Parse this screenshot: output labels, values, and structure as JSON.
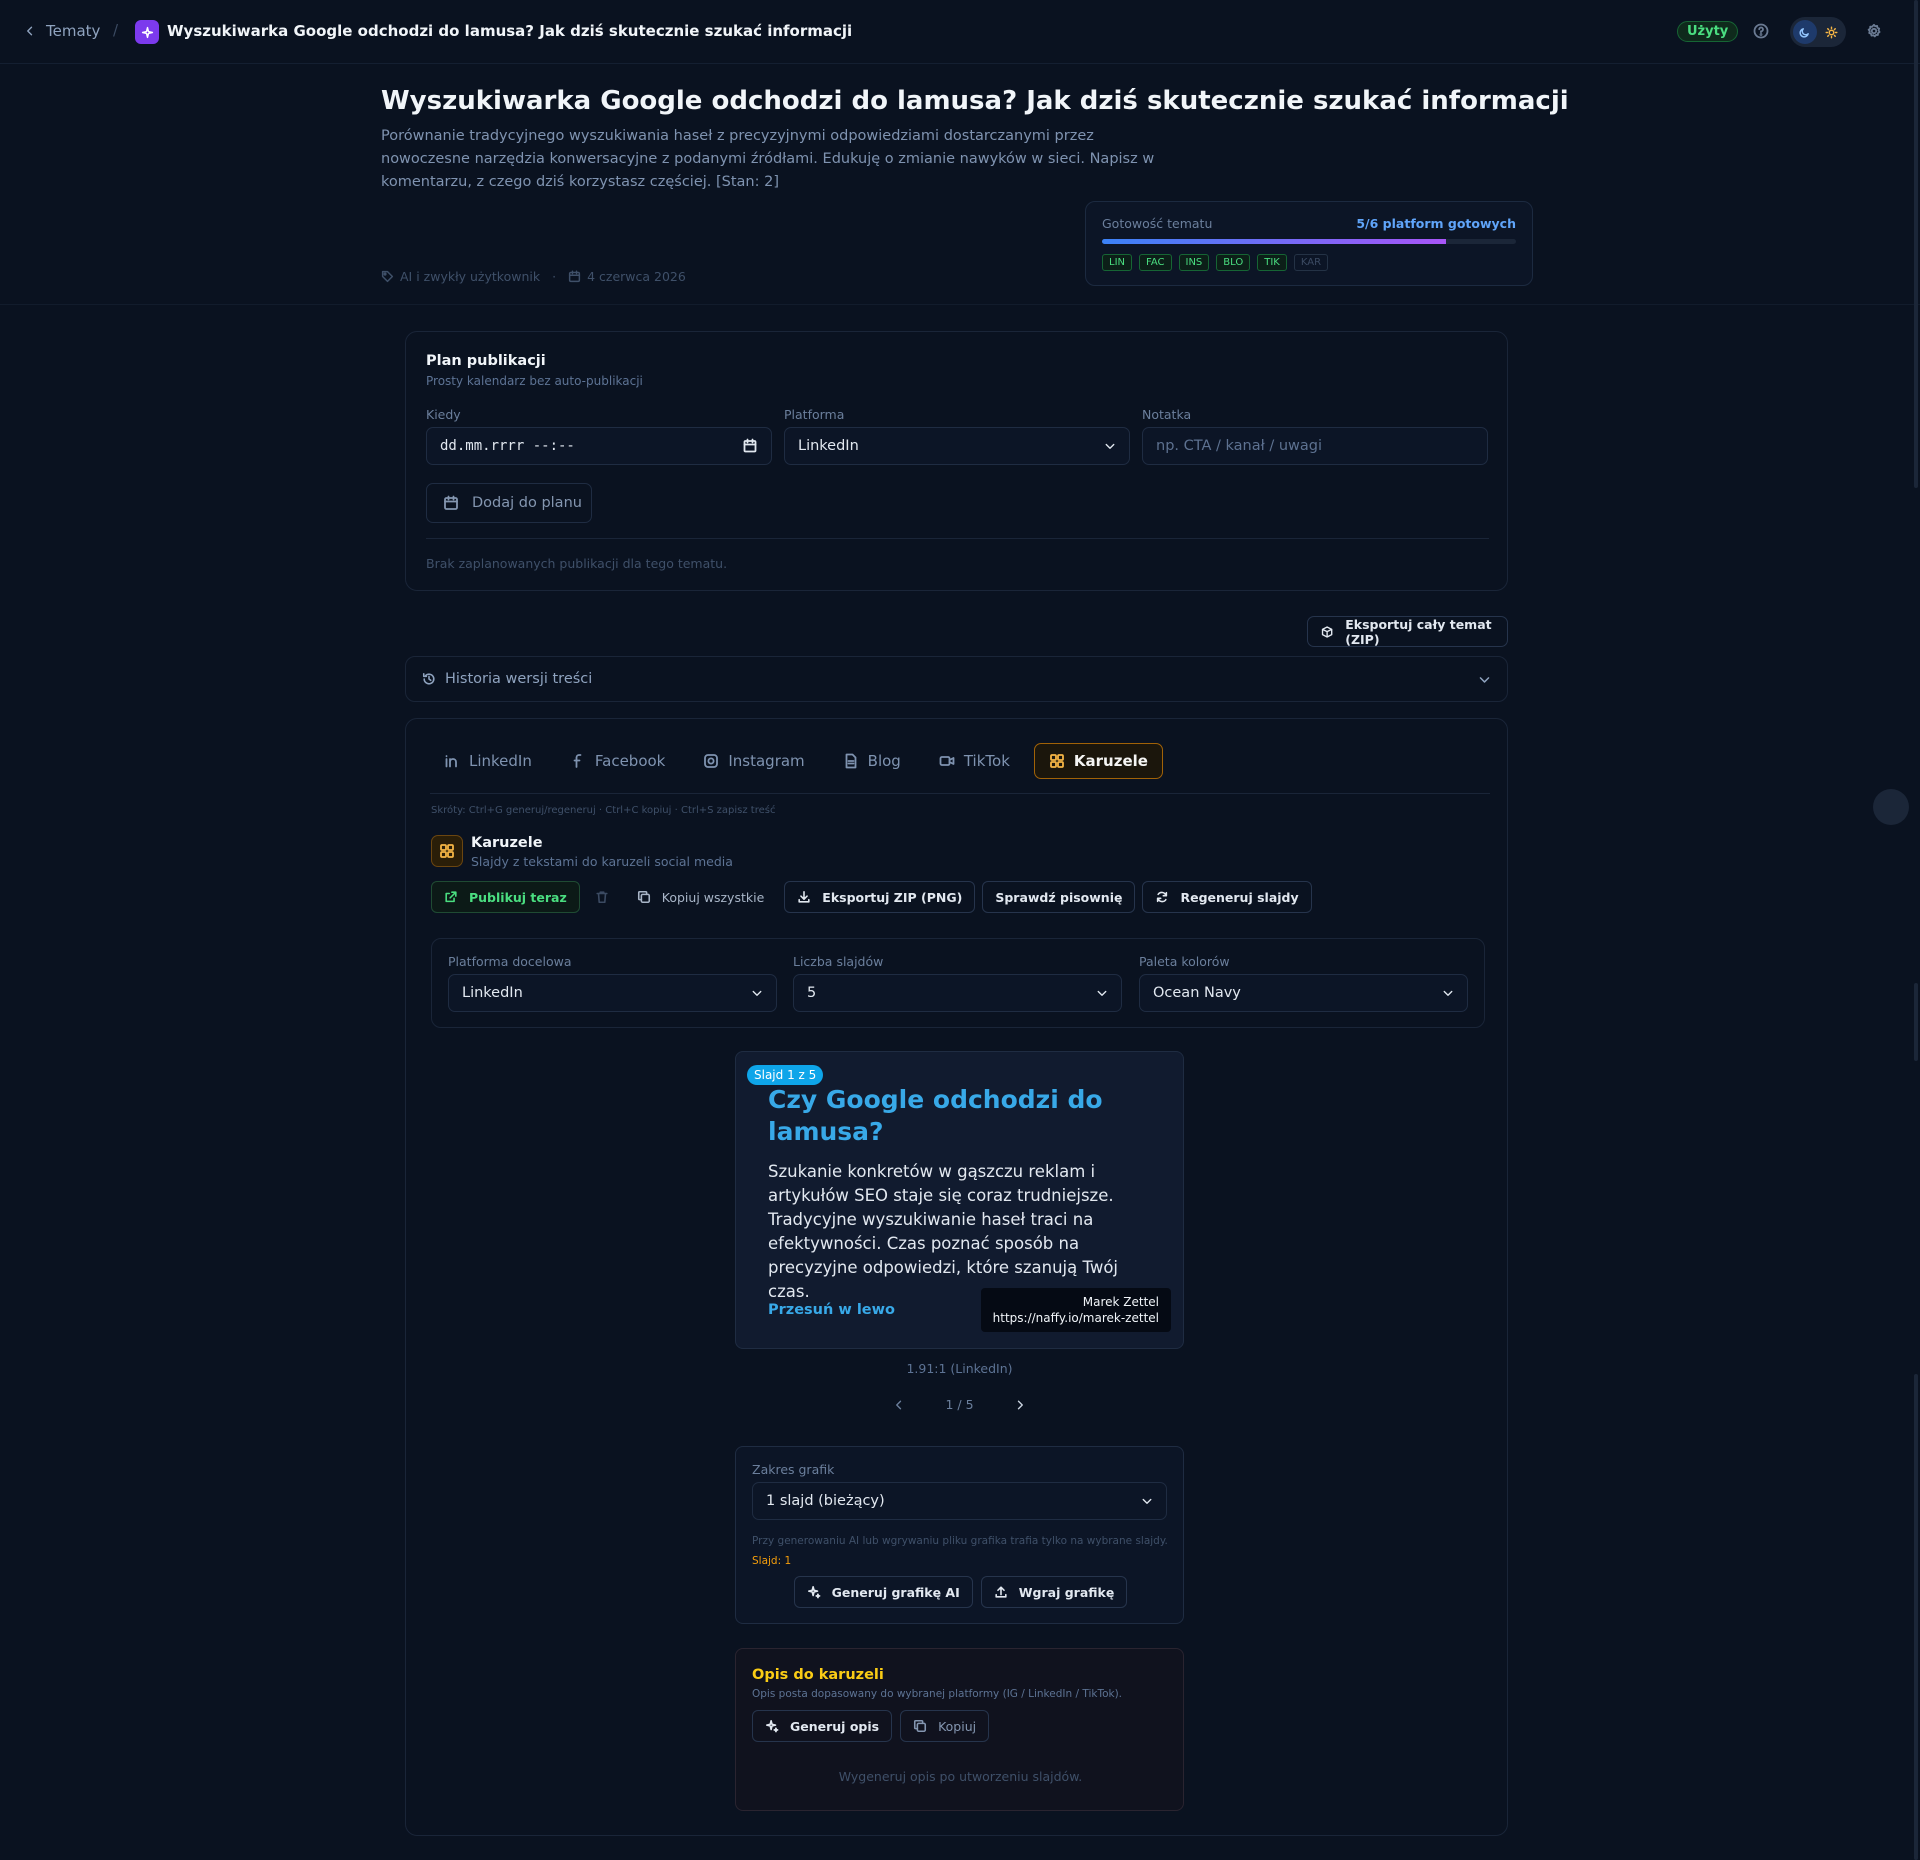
{
  "topbar": {
    "back_label": "Tematy",
    "separator": "/",
    "title": "Wyszukiwarka Google odchodzi do lamusa? Jak dziś skutecznie szukać informacji",
    "status_badge": "Użyty"
  },
  "header": {
    "title": "Wyszukiwarka Google odchodzi do lamusa? Jak dziś skutecznie szukać informacji",
    "description": "Porównanie tradycyjnego wyszukiwania haseł z precyzyjnymi odpowiedziami dostarczanymi przez nowoczesne narzędzia konwersacyjne z podanymi źródłami. Edukuję o zmianie nawyków w sieci. Napisz w komentarzu, z czego dziś korzystasz częściej. [Stan: 2]",
    "tag": "AI i zwykły użytkownik",
    "date": "4 czerwca 2026"
  },
  "readiness": {
    "label": "Gotowość tematu",
    "count_label": "5/6 platform gotowych",
    "progress": 0.83,
    "platforms": [
      {
        "code": "LIN",
        "ready": true
      },
      {
        "code": "FAC",
        "ready": true
      },
      {
        "code": "INS",
        "ready": true
      },
      {
        "code": "BLO",
        "ready": true
      },
      {
        "code": "TIK",
        "ready": true
      },
      {
        "code": "KAR",
        "ready": false
      }
    ]
  },
  "plan": {
    "title": "Plan publikacji",
    "subtitle": "Prosty kalendarz bez auto-publikacji",
    "when_label": "Kiedy",
    "when_value": "dd.mm.rrrr --:--",
    "platform_label": "Platforma",
    "platform_value": "LinkedIn",
    "note_label": "Notatka",
    "note_placeholder": "np. CTA / kanał / uwagi",
    "add_button": "Dodaj do planu",
    "empty_text": "Brak zaplanowanych publikacji dla tego tematu."
  },
  "export_all_label": "Eksportuj cały temat (ZIP)",
  "history_label": "Historia wersji treści",
  "tabs": [
    {
      "label": "LinkedIn",
      "icon": "linkedin-icon",
      "active": false
    },
    {
      "label": "Facebook",
      "icon": "facebook-icon",
      "active": false
    },
    {
      "label": "Instagram",
      "icon": "instagram-icon",
      "active": false
    },
    {
      "label": "Blog",
      "icon": "document-icon",
      "active": false
    },
    {
      "label": "TikTok",
      "icon": "video-icon",
      "active": false
    },
    {
      "label": "Karuzele",
      "icon": "grid-icon",
      "active": true
    }
  ],
  "shortcuts": "Skróty: Ctrl+G generuj/regeneruj · Ctrl+C kopiuj · Ctrl+S zapisz treść",
  "section": {
    "title": "Karuzele",
    "subtitle": "Slajdy z tekstami do karuzeli social media"
  },
  "actions": {
    "publish": "Publikuj teraz",
    "copy_all": "Kopiuj wszystkie",
    "export_zip": "Eksportuj ZIP (PNG)",
    "spellcheck": "Sprawdź pisownię",
    "regenerate": "Regeneruj slajdy"
  },
  "options": {
    "target_label": "Platforma docelowa",
    "target_value": "LinkedIn",
    "count_label": "Liczba slajdów",
    "count_value": "5",
    "palette_label": "Paleta kolorów",
    "palette_value": "Ocean Navy"
  },
  "slide": {
    "badge": "Slajd 1 z 5",
    "title": "Czy Google odchodzi do lamusa?",
    "body": "Szukanie konkretów w gąszczu reklam i artykułów SEO staje się coraz trudniejsze. Tradycyjne wyszukiwanie haseł traci na efektywności. Czas poznać sposób na precyzyjne odpowiedzi, które szanują Twój czas.",
    "swipe": "Przesuń w lewo",
    "author_name": "Marek Zettel",
    "author_url": "https://naffy.io/marek-zettel",
    "ratio": "1.91:1 (LinkedIn)",
    "pager": "1 / 5"
  },
  "graphics": {
    "label": "Zakres grafik",
    "value": "1 slajd (bieżący)",
    "note": "Przy generowaniu AI lub wgrywaniu pliku grafika trafia tylko na wybrane slajdy.",
    "slide_note": "Slajd: 1",
    "generate": "Generuj grafikę AI",
    "upload": "Wgraj grafikę"
  },
  "description": {
    "title": "Opis do karuzeli",
    "subtitle": "Opis posta dopasowany do wybranej platformy (IG / LinkedIn / TikTok).",
    "generate": "Generuj opis",
    "copy": "Kopiuj",
    "empty": "Wygeneruj opis po utworzeniu slajdów."
  },
  "colors": {
    "background": "#0a1220",
    "accent": "#38a9e8",
    "success": "#4ade80",
    "warning": "#f5b545",
    "brand": "#7c3aed"
  }
}
